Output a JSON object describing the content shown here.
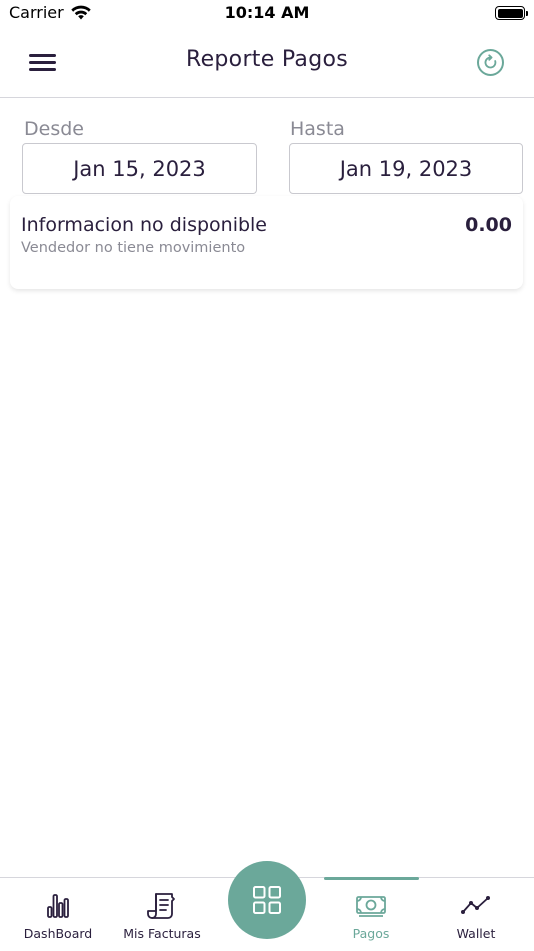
{
  "status_bar": {
    "carrier": "Carrier",
    "time": "10:14 AM"
  },
  "header": {
    "title": "Reporte Pagos",
    "menu_icon": "hamburger-menu-icon",
    "refresh_icon": "refresh-icon"
  },
  "filters": {
    "from_label": "Desde",
    "from_value": "Jan 15, 2023",
    "to_label": "Hasta",
    "to_value": "Jan 19, 2023"
  },
  "info_card": {
    "title": "Informacion no disponible",
    "subtitle": "Vendedor no tiene movimiento",
    "amount": "0.00"
  },
  "tab_bar": {
    "active_tab": "Pagos",
    "accent_color": "#6ba89a",
    "tabs": [
      {
        "label": "DashBoard",
        "icon": "bar-chart-icon"
      },
      {
        "label": "Mis Facturas",
        "icon": "invoice-icon"
      },
      {
        "label": "Pagos",
        "icon": "cash-icon"
      },
      {
        "label": "Wallet",
        "icon": "trend-line-icon"
      }
    ],
    "center_icon": "grid-icon"
  },
  "colors": {
    "primary_text": "#2a1f3d",
    "secondary_text": "#8a8a94",
    "accent": "#6ba89a"
  }
}
